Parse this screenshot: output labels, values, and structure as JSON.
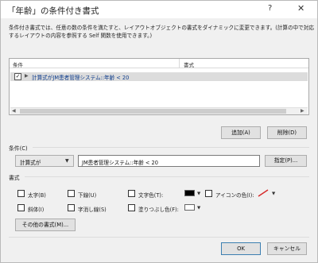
{
  "window": {
    "title": "「年齢」の条件付き書式",
    "help_label": "?",
    "close_label": "✕"
  },
  "description": "条件付き書式では、任意の数の条件を満たすと、レイアウトオブジェクトの書式をダイナミックに変更できます。(計算の中で対応するレイアウトの内容を参照する Self 関数を使用できます。)",
  "grid": {
    "columns": [
      "条件",
      "書式"
    ],
    "rows": [
      {
        "checked": true,
        "condition": "計算式がJM患者管理システム::年齢 < 20"
      }
    ],
    "check_glyph": "✓",
    "expand_glyph": "▶",
    "scroll_left": "◀",
    "scroll_right": "▶"
  },
  "buttons": {
    "add": "追加(A)",
    "delete": "削除(D)",
    "specify": "指定(P)...",
    "more_formats": "その他の書式(M)...",
    "ok": "OK",
    "cancel": "キャンセル"
  },
  "condition_section": {
    "label": "条件(C)",
    "type_value": "計算式が",
    "dropdown_glyph": "▼",
    "expression": "JM患者管理システム::年齢 < 20"
  },
  "format_section": {
    "label": "書式",
    "options": {
      "bold": "太字(B)",
      "underline": "下線(U)",
      "text_color": "文字色(T):",
      "icon_color": "アイコンの色(I):",
      "italic": "斜体(I)",
      "strikethrough": "字消し線(S)",
      "fill_color": "塗りつぶし色(F):"
    },
    "colors": {
      "text_color": "#000000",
      "fill_color": "#ffffff",
      "icon_color": "#d62828"
    }
  }
}
